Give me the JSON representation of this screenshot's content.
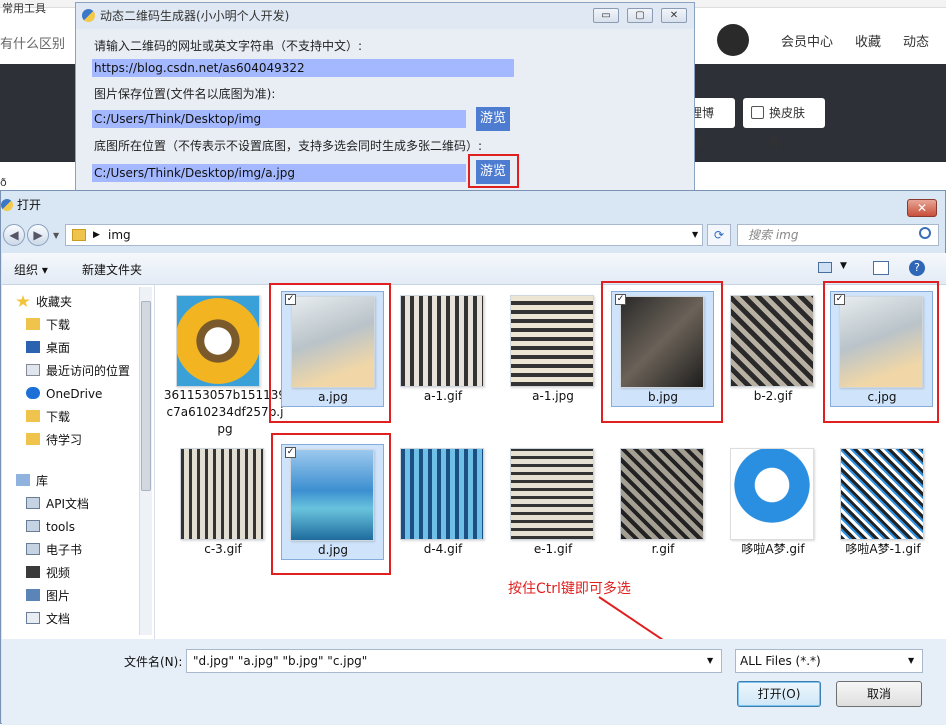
{
  "browser": {
    "left_text": "有什么区别",
    "top_left": "常用工具",
    "nav": [
      "会员中心",
      "收藏",
      "动态"
    ],
    "buttons": [
      "理博客",
      "换皮肤啦"
    ],
    "side_text": "ð"
  },
  "generator": {
    "title": "动态二维码生成器(小小明个人开发)",
    "label_url": "请输入二维码的网址或英文字符串（不支持中文）:",
    "url": "https://blog.csdn.net/as604049322",
    "label_save": "图片保存位置(文件名以底图为准):",
    "save_path": "C:/Users/Think/Desktop/img",
    "label_base": "底图所在位置（不传表示不设置底图，支持多选会同时生成多张二维码）:",
    "base_path": "C:/Users/Think/Desktop/img/a.jpg",
    "browse": "游览"
  },
  "dialog": {
    "title": "打开",
    "path": "img",
    "search_placeholder": "搜索 img",
    "organize": "组织",
    "new_folder": "新建文件夹",
    "nav_favorites": "收藏夹",
    "nav_items": [
      "下载",
      "桌面",
      "最近访问的位置",
      "OneDrive",
      "下载",
      "待学习"
    ],
    "nav_lib": "库",
    "lib_items": [
      "API文档",
      "tools",
      "电子书",
      "视频",
      "图片",
      "文档"
    ],
    "files_row1": [
      "361153057b151139c7a610234df257b.jpg",
      "a.jpg",
      "a-1.gif",
      "a-1.jpg",
      "b.jpg",
      "b-2.gif",
      "c.jpg"
    ],
    "files_row2": [
      "c-3.gif",
      "d.jpg",
      "d-4.gif",
      "e-1.gif",
      "r.gif",
      "哆啦A梦.gif",
      "哆啦A梦-1.gif"
    ],
    "filename_label": "文件名(N):",
    "filename_value": "\"d.jpg\" \"a.jpg\" \"b.jpg\" \"c.jpg\"",
    "filetype": "ALL Files (*.*)",
    "open": "打开(O)",
    "cancel": "取消",
    "annotation": "按住Ctrl键即可多选"
  }
}
